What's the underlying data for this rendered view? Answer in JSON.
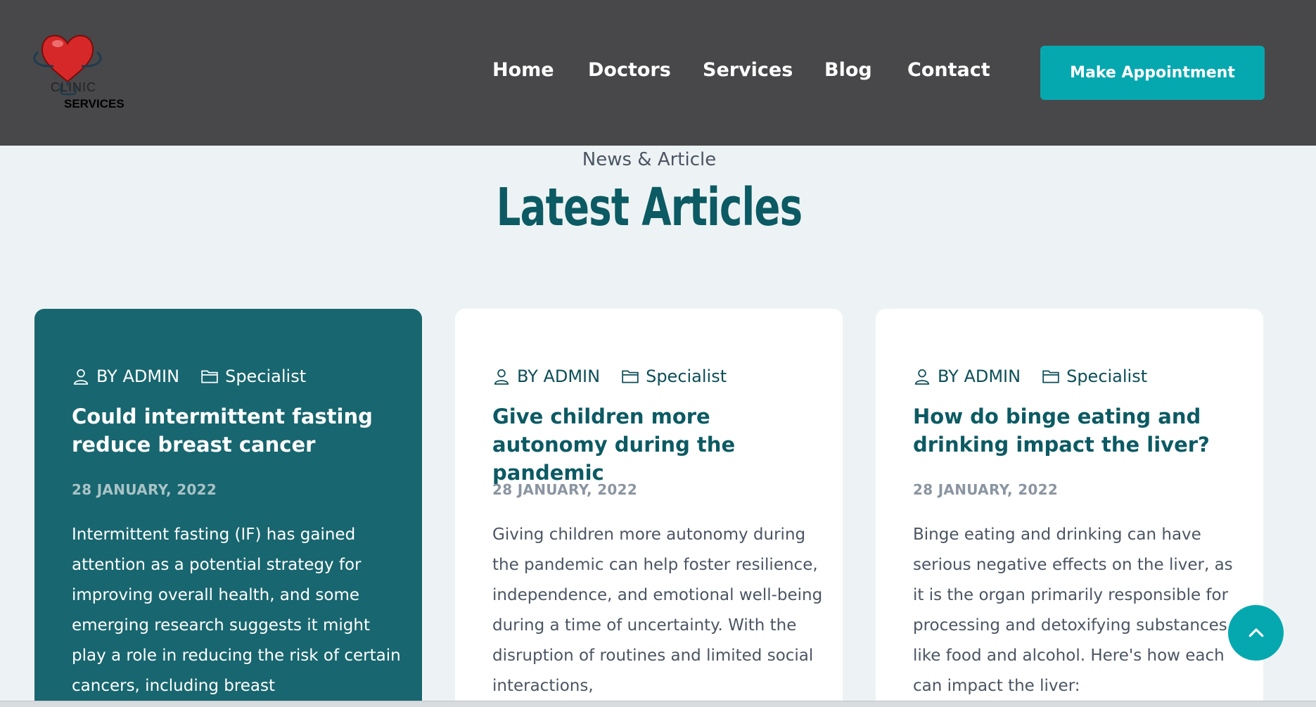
{
  "logo": {
    "line1": "CLINIC",
    "line2": "SERVICES"
  },
  "nav": {
    "items": [
      "Home",
      "Doctors",
      "Services",
      "Blog",
      "Contact"
    ]
  },
  "cta": {
    "label": "Make Appointment"
  },
  "section": {
    "eyebrow": "News & Article",
    "title": "Latest Articles"
  },
  "articles": [
    {
      "author": "BY ADMIN",
      "category": "Specialist",
      "title": "Could intermittent fasting reduce breast cancer",
      "date": "28 JANUARY, 2022",
      "excerpt": "Intermittent fasting (IF) has gained attention as a potential strategy for improving overall health, and some emerging research suggests it might play a role in reducing the risk of certain cancers, including breast"
    },
    {
      "author": "BY ADMIN",
      "category": "Specialist",
      "title": "Give children more autonomy during the pandemic",
      "date": "28 JANUARY, 2022",
      "excerpt": "Giving children more autonomy during the pandemic can help foster resilience, independence, and emotional well-being during a time of uncertainty. With the disruption of routines and limited social interactions,"
    },
    {
      "author": "BY ADMIN",
      "category": "Specialist",
      "title": "How do binge eating and drinking impact the liver?",
      "date": "28 JANUARY, 2022",
      "excerpt": "Binge eating and drinking can have serious negative effects on the liver, as it is the organ primarily responsible for processing and detoxifying substances like food and alcohol. Here's how each can impact the liver:"
    }
  ],
  "colors": {
    "header_bg": "#48484a",
    "accent": "#06a8b0",
    "primary_dark": "#0c5a63",
    "active_card": "#18666f",
    "page_bg": "#edf3f4"
  },
  "icons": {
    "author": "user-icon",
    "category": "folder-icon",
    "scroll_top": "chevron-up-icon",
    "logo": "heart-stethoscope-icon"
  }
}
